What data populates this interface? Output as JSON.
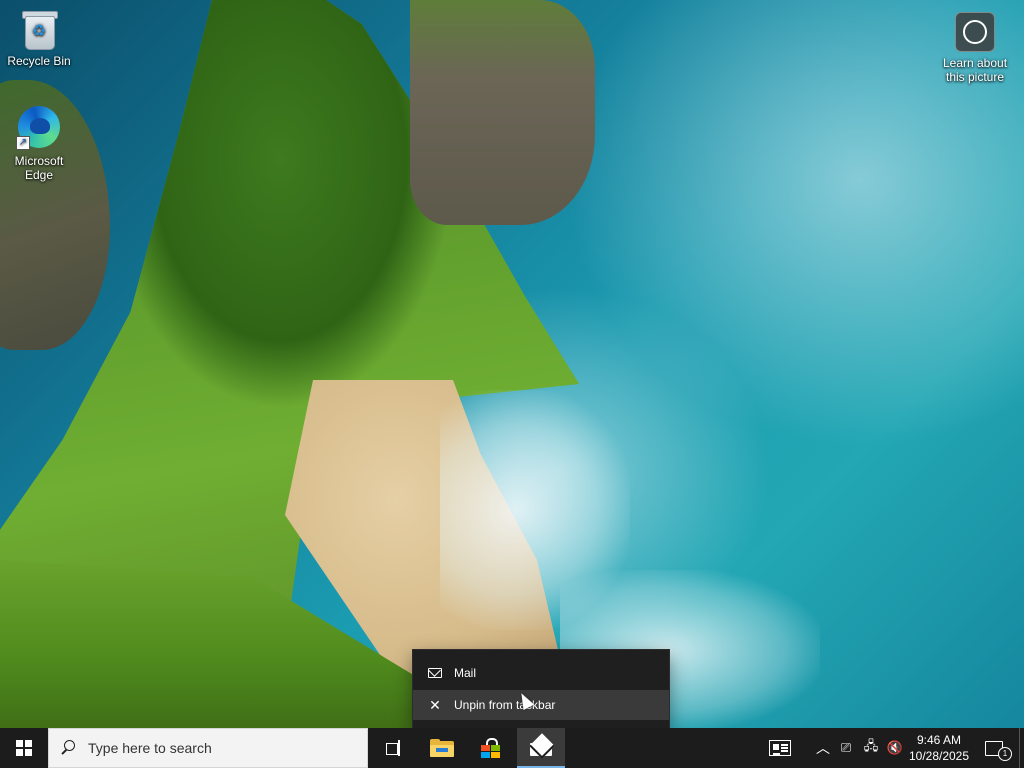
{
  "desktop": {
    "icons": [
      {
        "label": "Recycle Bin",
        "icon": "recycle-bin-icon"
      },
      {
        "label": "Microsoft Edge",
        "icon": "edge-icon"
      },
      {
        "label": "Learn about this picture",
        "icon": "camera-icon"
      }
    ]
  },
  "jumplist": {
    "items": [
      {
        "label": "Mail",
        "icon": "mail-icon"
      },
      {
        "label": "Unpin from taskbar",
        "icon": "unpin-icon"
      }
    ]
  },
  "taskbar": {
    "search_placeholder": "Type here to search",
    "apps": [
      {
        "name": "Task View",
        "icon": "task-view-icon"
      },
      {
        "name": "File Explorer",
        "icon": "folder-icon"
      },
      {
        "name": "Microsoft Store",
        "icon": "store-icon"
      },
      {
        "name": "Mail",
        "icon": "mail-icon"
      }
    ],
    "tray": {
      "time": "9:46 AM",
      "date": "10/28/2025",
      "notification_count": "1"
    }
  },
  "colors": {
    "taskbar_bg": "#1c1c1c",
    "menu_bg": "#1f1f1f",
    "menu_hover": "#3a3a3a",
    "accent": "#7ab5ea"
  }
}
